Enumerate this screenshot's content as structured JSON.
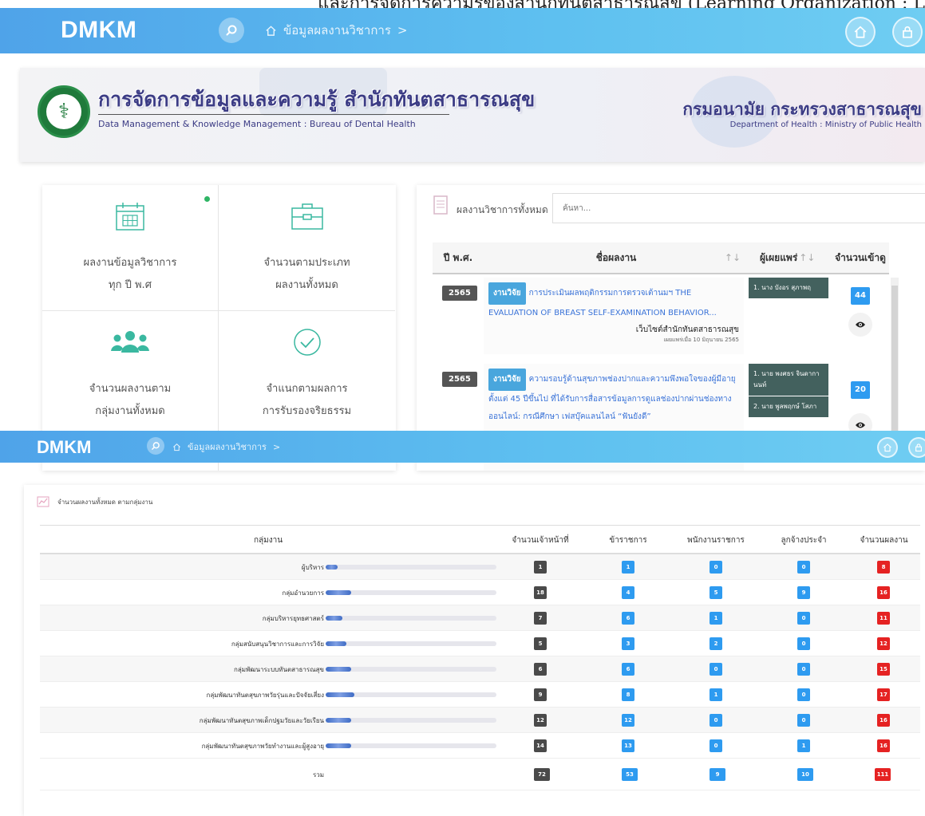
{
  "caption": "และการจัดการความรู้ของสำนักทันตสาธารณสุข (Learning Organization : L",
  "nav": {
    "brand": "DMKM",
    "breadcrumb": "ข้อมูลผลงานวิชาการ",
    "breadcrumb_sep": ">"
  },
  "banner": {
    "title": "การจัดการข้อมูลและความรู้ สำนักทันตสาธารณสุข",
    "subtitle": "Data Management & Knowledge Management : Bureau of Dental Health",
    "right_title": "กรมอนามัย กระทรวงสาธารณสุข",
    "right_subtitle": "Department of Health : Ministry of Public Health"
  },
  "tiles": [
    {
      "line1": "ผลงานข้อมูลวิชาการ",
      "line2": "ทุก ปี พ.ศ",
      "icon": "calendar-icon"
    },
    {
      "line1": "จำนวนตามประเภท",
      "line2": "ผลงานทั้งหมด",
      "icon": "briefcase-icon"
    },
    {
      "line1": "จำนวนผลงานตาม",
      "line2": "กลุ่มงานทั้งหมด",
      "icon": "people-icon"
    },
    {
      "line1": "จำแนกตามผลการ",
      "line2": "การรับรองจริยธรรม",
      "icon": "check-circle-icon"
    }
  ],
  "works": {
    "title": "ผลงานวิชาการทั้งหมด",
    "search_placeholder": "ค้นหา...",
    "columns": [
      "ปี พ.ศ.",
      "ชื่อผลงาน",
      "ผู้เผยแพร่",
      "จำนวนเข้าดู"
    ],
    "sort_arrows": "↑↓",
    "rows": [
      {
        "year": "2565",
        "tag": "งานวิจัย",
        "title": "การประเมินผลพฤติกรรมการตรวจเต้านมฯ THE EVALUATION OF BREAST SELF-EXAMINATION BEHAVIOR...",
        "source": "เว็บไซต์สำนักทันตสาธารณสุข",
        "date": "เผยแพร่เมื่อ 10 มิถุนายน 2565",
        "authors": [
          "1. นาง บังอร สุภาพฤ"
        ],
        "views": "44"
      },
      {
        "year": "2565",
        "tag": "งานวิจัย",
        "title": "ความรอบรู้ด้านสุขภาพช่องปากและความพึงพอใจของผู้มีอายุตั้งแต่ 45 ปีขึ้นไป ที่ได้รับการสื่อสารข้อมูลการดูแลช่องปากผ่านช่องทางออนไลน์: กรณีศึกษา เฟสบุ๊คแลนไลน์ “ฟันยังดี”",
        "source": "",
        "date": "",
        "authors": [
          "1. นาย พงศธร จินดากานนท์",
          "2. นาย พูลพฤกษ์ โสภา"
        ],
        "views": "20"
      }
    ]
  },
  "groups": {
    "title": "จำนวนผลงานทั้งหมด ตามกลุ่มงาน",
    "columns": [
      "กลุ่มงาน",
      "จำนวนเจ้าหน้าที่",
      "ข้าราชการ",
      "พนักงานราชการ",
      "ลูกจ้างประจำ",
      "จำนวนผลงาน"
    ],
    "rows": [
      {
        "name": "ผู้บริหาร",
        "progress": 0.07,
        "staff": "1",
        "civil": "1",
        "gov_emp": "0",
        "perm": "0",
        "works": "8"
      },
      {
        "name": "กลุ่มอำนวยการ",
        "progress": 0.15,
        "staff": "18",
        "civil": "4",
        "gov_emp": "5",
        "perm": "9",
        "works": "16"
      },
      {
        "name": "กลุ่มบริหารยุทธศาสตร์",
        "progress": 0.1,
        "staff": "7",
        "civil": "6",
        "gov_emp": "1",
        "perm": "0",
        "works": "11"
      },
      {
        "name": "กลุ่มสนับสนุนวิชาการและการวิจัย",
        "progress": 0.12,
        "staff": "5",
        "civil": "3",
        "gov_emp": "2",
        "perm": "0",
        "works": "12"
      },
      {
        "name": "กลุ่มพัฒนาระบบทันตสาธารณสุข",
        "progress": 0.15,
        "staff": "6",
        "civil": "6",
        "gov_emp": "0",
        "perm": "0",
        "works": "15"
      },
      {
        "name": "กลุ่มพัฒนาทันตสุขภาพวัยรุ่นและปัจจัยเสี่ยง",
        "progress": 0.17,
        "staff": "9",
        "civil": "8",
        "gov_emp": "1",
        "perm": "0",
        "works": "17"
      },
      {
        "name": "กลุ่มพัฒนาทันตสุขภาพเด็กปฐมวัยและวัยเรียน",
        "progress": 0.15,
        "staff": "12",
        "civil": "12",
        "gov_emp": "0",
        "perm": "0",
        "works": "16"
      },
      {
        "name": "กลุ่มพัฒนาทันตสุขภาพวัยทำงานและผู้สูงอายุ",
        "progress": 0.15,
        "staff": "14",
        "civil": "13",
        "gov_emp": "0",
        "perm": "1",
        "works": "16"
      }
    ],
    "total": {
      "name": "รวม",
      "staff": "72",
      "civil": "53",
      "gov_emp": "9",
      "perm": "10",
      "works": "111"
    }
  },
  "colors": {
    "nav_start": "#4fa3e9",
    "nav_end": "#6fcdf2",
    "banner_text": "#3c3c85",
    "tile_icon": "#3ab8a0",
    "view_badge": "#2e9bf0",
    "works_badge": "#e52222",
    "author_bg": "#43615e"
  }
}
